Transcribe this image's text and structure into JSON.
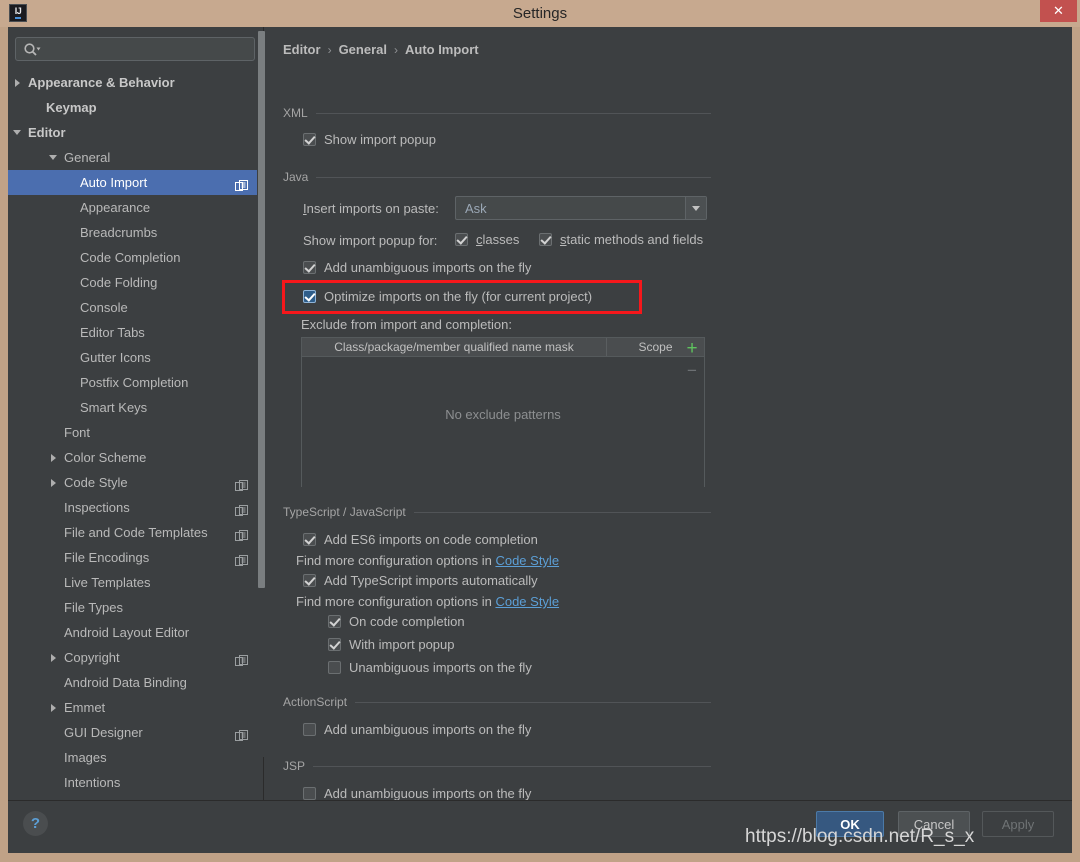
{
  "window": {
    "title": "Settings",
    "app_icon": "intellij-idea-icon",
    "close_label": "✕",
    "titlebar_color": "#c7a98f",
    "close_color": "#c2514f"
  },
  "search": {
    "placeholder": "",
    "value": "",
    "icon": "search-icon"
  },
  "sidebar": {
    "items": [
      {
        "label": "Appearance & Behavior",
        "indent": 20,
        "twisty": "collapsed",
        "bold": true,
        "selected": false,
        "badge": false
      },
      {
        "label": "Keymap",
        "indent": 38,
        "twisty": "none",
        "bold": true,
        "selected": false,
        "badge": false
      },
      {
        "label": "Editor",
        "indent": 20,
        "twisty": "expanded",
        "bold": true,
        "selected": false,
        "badge": false
      },
      {
        "label": "General",
        "indent": 56,
        "twisty": "expanded",
        "bold": false,
        "selected": false,
        "badge": false
      },
      {
        "label": "Auto Import",
        "indent": 72,
        "twisty": "none",
        "bold": false,
        "selected": true,
        "badge": true
      },
      {
        "label": "Appearance",
        "indent": 72,
        "twisty": "none",
        "bold": false,
        "selected": false,
        "badge": false
      },
      {
        "label": "Breadcrumbs",
        "indent": 72,
        "twisty": "none",
        "bold": false,
        "selected": false,
        "badge": false
      },
      {
        "label": "Code Completion",
        "indent": 72,
        "twisty": "none",
        "bold": false,
        "selected": false,
        "badge": false
      },
      {
        "label": "Code Folding",
        "indent": 72,
        "twisty": "none",
        "bold": false,
        "selected": false,
        "badge": false
      },
      {
        "label": "Console",
        "indent": 72,
        "twisty": "none",
        "bold": false,
        "selected": false,
        "badge": false
      },
      {
        "label": "Editor Tabs",
        "indent": 72,
        "twisty": "none",
        "bold": false,
        "selected": false,
        "badge": false
      },
      {
        "label": "Gutter Icons",
        "indent": 72,
        "twisty": "none",
        "bold": false,
        "selected": false,
        "badge": false
      },
      {
        "label": "Postfix Completion",
        "indent": 72,
        "twisty": "none",
        "bold": false,
        "selected": false,
        "badge": false
      },
      {
        "label": "Smart Keys",
        "indent": 72,
        "twisty": "none",
        "bold": false,
        "selected": false,
        "badge": false
      },
      {
        "label": "Font",
        "indent": 56,
        "twisty": "none",
        "bold": false,
        "selected": false,
        "badge": false
      },
      {
        "label": "Color Scheme",
        "indent": 56,
        "twisty": "collapsed",
        "bold": false,
        "selected": false,
        "badge": false
      },
      {
        "label": "Code Style",
        "indent": 56,
        "twisty": "collapsed",
        "bold": false,
        "selected": false,
        "badge": true
      },
      {
        "label": "Inspections",
        "indent": 56,
        "twisty": "none",
        "bold": false,
        "selected": false,
        "badge": true
      },
      {
        "label": "File and Code Templates",
        "indent": 56,
        "twisty": "none",
        "bold": false,
        "selected": false,
        "badge": true
      },
      {
        "label": "File Encodings",
        "indent": 56,
        "twisty": "none",
        "bold": false,
        "selected": false,
        "badge": true
      },
      {
        "label": "Live Templates",
        "indent": 56,
        "twisty": "none",
        "bold": false,
        "selected": false,
        "badge": false
      },
      {
        "label": "File Types",
        "indent": 56,
        "twisty": "none",
        "bold": false,
        "selected": false,
        "badge": false
      },
      {
        "label": "Android Layout Editor",
        "indent": 56,
        "twisty": "none",
        "bold": false,
        "selected": false,
        "badge": false
      },
      {
        "label": "Copyright",
        "indent": 56,
        "twisty": "collapsed",
        "bold": false,
        "selected": false,
        "badge": true
      },
      {
        "label": "Android Data Binding",
        "indent": 56,
        "twisty": "none",
        "bold": false,
        "selected": false,
        "badge": false
      },
      {
        "label": "Emmet",
        "indent": 56,
        "twisty": "collapsed",
        "bold": false,
        "selected": false,
        "badge": false
      },
      {
        "label": "GUI Designer",
        "indent": 56,
        "twisty": "none",
        "bold": false,
        "selected": false,
        "badge": true
      },
      {
        "label": "Images",
        "indent": 56,
        "twisty": "none",
        "bold": false,
        "selected": false,
        "badge": false
      },
      {
        "label": "Intentions",
        "indent": 56,
        "twisty": "none",
        "bold": false,
        "selected": false,
        "badge": false
      }
    ],
    "selection_color": "#4b6eaf"
  },
  "breadcrumb": {
    "part1": "Editor",
    "sep1": "›",
    "part2": "General",
    "sep2": "›",
    "part3": "Auto Import"
  },
  "sections": {
    "xml": {
      "title": "XML",
      "show_import_popup": {
        "label": "Show import popup",
        "checked": true
      }
    },
    "java": {
      "title": "Java",
      "insert_imports_label": "Insert imports on paste:",
      "insert_imports_value": "Ask",
      "insert_imports_options": [
        "Ask"
      ],
      "show_popup_for_label": "Show import popup for:",
      "classes": {
        "label": "classes",
        "checked": true
      },
      "static_methods": {
        "label": "static methods and fields",
        "checked": true
      },
      "add_unambiguous": {
        "label": "Add unambiguous imports on the fly",
        "checked": true
      },
      "optimize_imports": {
        "label": "Optimize imports on the fly (for current project)",
        "checked": true,
        "focused": true,
        "highlighted": true
      },
      "exclude_label": "Exclude from import and completion:",
      "table": {
        "columns": [
          "Class/package/member qualified name mask",
          "Scope"
        ],
        "rows": [],
        "empty_text": "No exclude patterns",
        "add_button": "+",
        "remove_button": "−"
      }
    },
    "typescript": {
      "title": "TypeScript / JavaScript",
      "add_es6": {
        "label": "Add ES6 imports on code completion",
        "checked": true
      },
      "hint1_prefix": "Find more configuration options in ",
      "hint1_link": "Code Style",
      "add_ts": {
        "label": "Add TypeScript imports automatically",
        "checked": true
      },
      "hint2_prefix": "Find more configuration options in ",
      "hint2_link": "Code Style",
      "on_code_completion": {
        "label": "On code completion",
        "checked": true
      },
      "with_import_popup": {
        "label": "With import popup",
        "checked": true
      },
      "unambiguous_fly": {
        "label": "Unambiguous imports on the fly",
        "checked": false
      }
    },
    "actionscript": {
      "title": "ActionScript",
      "add_unambiguous": {
        "label": "Add unambiguous imports on the fly",
        "checked": false
      }
    },
    "jsp": {
      "title": "JSP",
      "add_unambiguous": {
        "label": "Add unambiguous imports on the fly",
        "checked": false
      }
    }
  },
  "footer": {
    "help": "?",
    "ok": "OK",
    "cancel": "Cancel",
    "apply": "Apply"
  },
  "watermark": "https://blog.csdn.net/R_s_x",
  "annotation": {
    "color": "#f6171b",
    "target": "optimize-imports-on-the-fly-checkbox"
  }
}
